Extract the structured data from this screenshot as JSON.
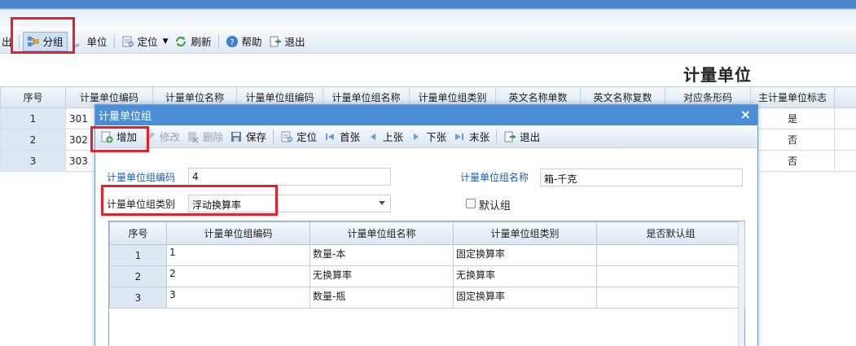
{
  "toolbar": {
    "items": [
      {
        "label": "出"
      },
      {
        "label": "分组"
      },
      {
        "label": "单位"
      },
      {
        "label": "定位"
      },
      {
        "label": "刷新"
      },
      {
        "label": "帮助"
      },
      {
        "label": "退出"
      }
    ]
  },
  "page_title": "计量单位",
  "main_grid": {
    "columns": [
      "序号",
      "计量单位编码",
      "计量单位名称",
      "计量单位组编码",
      "计量单位组名称",
      "计量单位组类别",
      "英文名称单数",
      "英文名称复数",
      "对应条形码",
      "主计量单位标志"
    ],
    "rows": [
      {
        "index": "1",
        "code": "301",
        "primary": "是"
      },
      {
        "index": "2",
        "code": "302",
        "primary": "否"
      },
      {
        "index": "3",
        "code": "303",
        "primary": "否"
      }
    ]
  },
  "dialog": {
    "title": "计量单位组",
    "close": "×",
    "toolbar": {
      "add": "增加",
      "edit": "修改",
      "delete": "删除",
      "save": "保存",
      "locate": "定位",
      "first": "首张",
      "prev": "上张",
      "next": "下张",
      "last": "末张",
      "exit": "退出"
    },
    "form": {
      "code_label": "计量单位组编码",
      "code_value": "4",
      "name_label": "计量单位组名称",
      "name_value": "箱-千克",
      "type_label": "计量单位组类别",
      "type_value": "浮动换算率",
      "default_label": "默认组"
    },
    "grid": {
      "columns": [
        "序号",
        "计量单位组编码",
        "计量单位组名称",
        "计量单位组类别",
        "是否默认组"
      ],
      "rows": [
        {
          "index": "1",
          "code": "1",
          "name": "数量-本",
          "type": "固定换算率",
          "default": ""
        },
        {
          "index": "2",
          "code": "2",
          "name": "无换算率",
          "type": "无换算率",
          "default": ""
        },
        {
          "index": "3",
          "code": "3",
          "name": "数量-瓶",
          "type": "固定换算率",
          "default": ""
        }
      ]
    }
  },
  "colors": {
    "accent": "#4a8fd6",
    "highlight_box": "#e8202a",
    "label_blue": "#1a5fb4"
  }
}
